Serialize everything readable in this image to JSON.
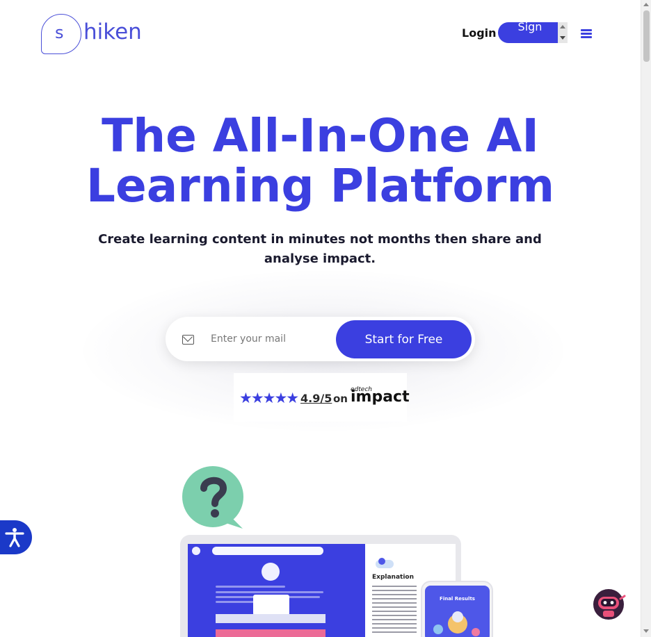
{
  "header": {
    "logo_letter": "s",
    "logo_text": "hiken",
    "login_label": "Login",
    "signup_label": "Sign Up",
    "menu_icon": "hamburger-menu-icon"
  },
  "hero": {
    "headline": "The All-In-One AI Learning Platform",
    "subheadline": "Create learning content in minutes not months then share and analyse impact.",
    "email_placeholder": "Enter your mail",
    "email_value": "",
    "cta_label": "Start for Free"
  },
  "rating": {
    "stars": "★★★★★",
    "score": "4.9/5",
    "on": "on",
    "brand_small": "edtech",
    "brand": "impact"
  },
  "illustration": {
    "panel_title": "Explanation",
    "phone_title": "Final Results"
  },
  "colors": {
    "brand": "#3b3fe0",
    "accessibility": "#1b39c8"
  }
}
